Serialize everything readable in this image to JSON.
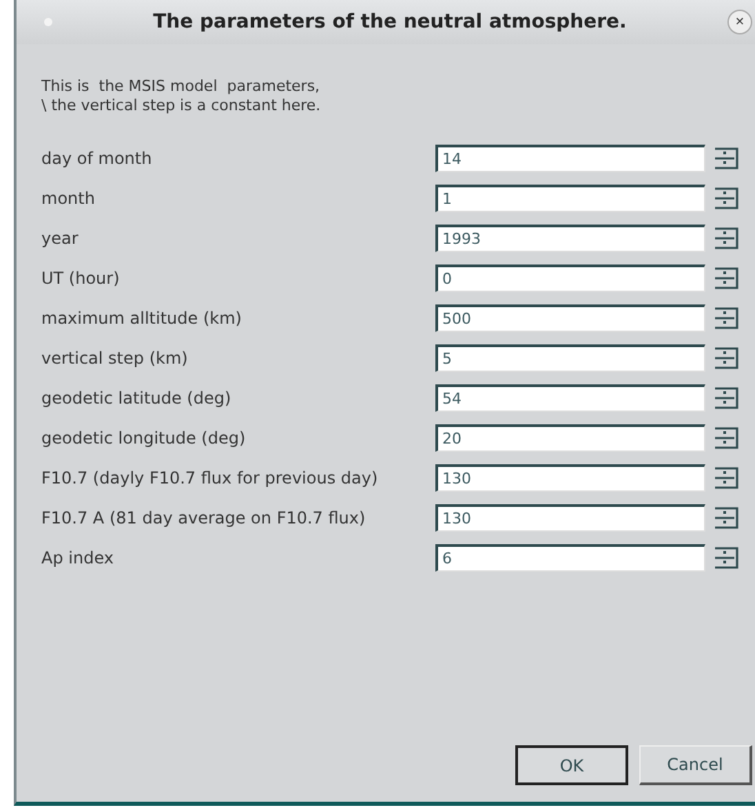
{
  "window": {
    "title": "The parameters of the neutral atmosphere.",
    "close": "×"
  },
  "description": "This is  the MSIS model  parameters,\n\\ the vertical step is a constant here.",
  "fields": [
    {
      "label": "day of month",
      "value": "14"
    },
    {
      "label": "month",
      "value": "1"
    },
    {
      "label": "year",
      "value": "1993"
    },
    {
      "label": "UT (hour)",
      "value": "0"
    },
    {
      "label": "maximum alltitude (km)",
      "value": "500"
    },
    {
      "label": "vertical step (km)",
      "value": "5"
    },
    {
      "label": "geodetic latitude (deg)",
      "value": "54"
    },
    {
      "label": "geodetic longitude (deg)",
      "value": "20"
    },
    {
      "label": "F10.7 (dayly F10.7 flux for previous day)",
      "value": "130"
    },
    {
      "label": "F10.7 A (81 day average on F10.7 flux)",
      "value": "130"
    },
    {
      "label": "Ap index",
      "value": "6"
    }
  ],
  "buttons": [
    {
      "label": "OK",
      "default": true
    },
    {
      "label": "Cancel",
      "default": false
    }
  ]
}
